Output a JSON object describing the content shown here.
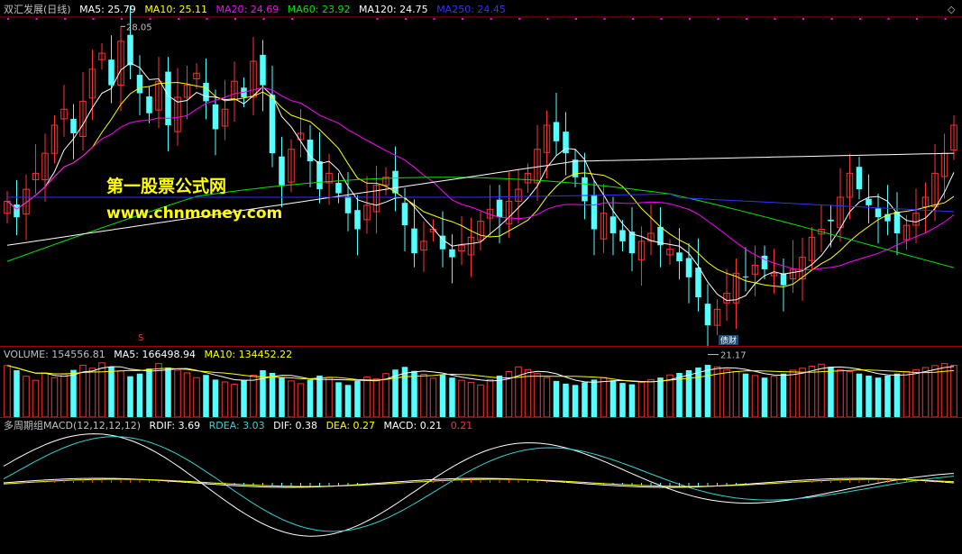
{
  "colors": {
    "bg": "#000000",
    "up": "#ff3232",
    "down": "#54ffff",
    "ma5": "#ffffff",
    "ma10": "#ffff00",
    "ma20": "#ff00ff",
    "ma60": "#00e600",
    "ma120": "#ffffff",
    "ma250": "#3232ff",
    "vol_ma5": "#ffffff",
    "vol_ma10": "#ffff00",
    "rdif": "#ffffff",
    "rdea": "#32d4d4",
    "dif": "#ffffff",
    "dea": "#ffff00",
    "macd_val": "#ff3232",
    "border": "#a00000",
    "label_text": "#c0c0c0"
  },
  "price_header": {
    "title": "双汇发展(日线)",
    "ma5": "MA5: 25.79",
    "ma10": "MA10: 25.11",
    "ma20": "MA20: 24.69",
    "ma60": "MA60: 23.92",
    "ma120": "MA120: 24.75",
    "ma250": "MA250: 24.45"
  },
  "volume_header": {
    "label": "VOLUME: 154556.81",
    "ma5": "MA5: 166498.94",
    "ma10": "MA10: 134452.22"
  },
  "macd_header": {
    "label": "多周期组MACD(12,12,12,12)",
    "rdif": "RDIF: 3.69",
    "rdea": "RDEA: 3.03",
    "dif": "DIF: 0.38",
    "dea": "DEA: 0.27",
    "macd": "MACD: 0.21",
    "macd_val": "0.21"
  },
  "annotations": {
    "high": "28.05",
    "low": "21.17",
    "badge": "债财",
    "marker": "S"
  },
  "watermark": {
    "line1": "第一股票公式网",
    "line2": "www.chnmoney.com"
  },
  "chart_data": [
    {
      "type": "candlestick",
      "title": "双汇发展(日线)",
      "series_note": "daily OHLC, approximate",
      "close": [
        23.9,
        23.5,
        24.2,
        24.6,
        25.1,
        25.8,
        26.2,
        25.6,
        26.4,
        27.2,
        27.6,
        26.8,
        27.9,
        27.3,
        26.6,
        26.1,
        26.9,
        25.8,
        26.5,
        26.8,
        27.1,
        26.4,
        25.7,
        26.2,
        26.9,
        26.5,
        27.4,
        26.8,
        25.1,
        24.3,
        25.2,
        25.6,
        24.9,
        24.2,
        24.6,
        24.1,
        23.6,
        23.2,
        23.8,
        24.3,
        24.5,
        24.1,
        23.3,
        22.6,
        22.9,
        23.2,
        22.7,
        22.5,
        22.8,
        23.0,
        23.4,
        23.7,
        23.5,
        23.9,
        24.2,
        24.6,
        25.2,
        25.8,
        25.4,
        25.1,
        24.5,
        23.9,
        23.2,
        23.6,
        23.1,
        22.9,
        22.6,
        22.9,
        23.1,
        22.8,
        22.7,
        22.4,
        22.0,
        21.5,
        20.8,
        21.2,
        21.6,
        22.1,
        22.0,
        22.3,
        22.2,
        22.1,
        21.8,
        22.2,
        22.5,
        23.0,
        23.2,
        23.4,
        24.0,
        24.6,
        24.2,
        23.8,
        23.5,
        23.4,
        23.1,
        23.3,
        23.6,
        24.0,
        24.6,
        25.1,
        25.8
      ]
    },
    {
      "type": "bar",
      "title": "VOLUME",
      "values": [
        154000,
        140000,
        122000,
        110000,
        132000,
        118000,
        128000,
        141000,
        155000,
        146000,
        162000,
        150000,
        138000,
        122000,
        130000,
        145000,
        160000,
        148000,
        140000,
        132000,
        118000,
        126000,
        112000,
        105000,
        98000,
        110000,
        125000,
        140000,
        132000,
        118000,
        108000,
        100000,
        112000,
        124000,
        118000,
        104000,
        96000,
        108000,
        120000,
        114000,
        130000,
        142000,
        150000,
        138000,
        128000,
        116000,
        126000,
        118000,
        110000,
        104000,
        96000,
        112000,
        124000,
        136000,
        150000,
        142000,
        130000,
        118000,
        108000,
        100000,
        96000,
        104000,
        112000,
        118000,
        110000,
        102000,
        98000,
        104000,
        112000,
        118000,
        126000,
        132000,
        140000,
        148000,
        156000,
        150000,
        142000,
        136000,
        130000,
        124000,
        118000,
        122000,
        130000,
        140000,
        146000,
        152000,
        158000,
        150000,
        142000,
        136000,
        130000,
        124000,
        118000,
        124000,
        130000,
        136000,
        142000,
        148000,
        154000,
        160000,
        154556
      ]
    },
    {
      "type": "line",
      "title": "多周期组MACD(12,12,12,12)",
      "series": [
        {
          "name": "RDIF",
          "values": [
            3.69
          ]
        },
        {
          "name": "RDEA",
          "values": [
            3.03
          ]
        },
        {
          "name": "DIF",
          "values": [
            0.38
          ]
        },
        {
          "name": "DEA",
          "values": [
            0.27
          ]
        },
        {
          "name": "MACD",
          "values": [
            0.21
          ]
        }
      ]
    }
  ]
}
